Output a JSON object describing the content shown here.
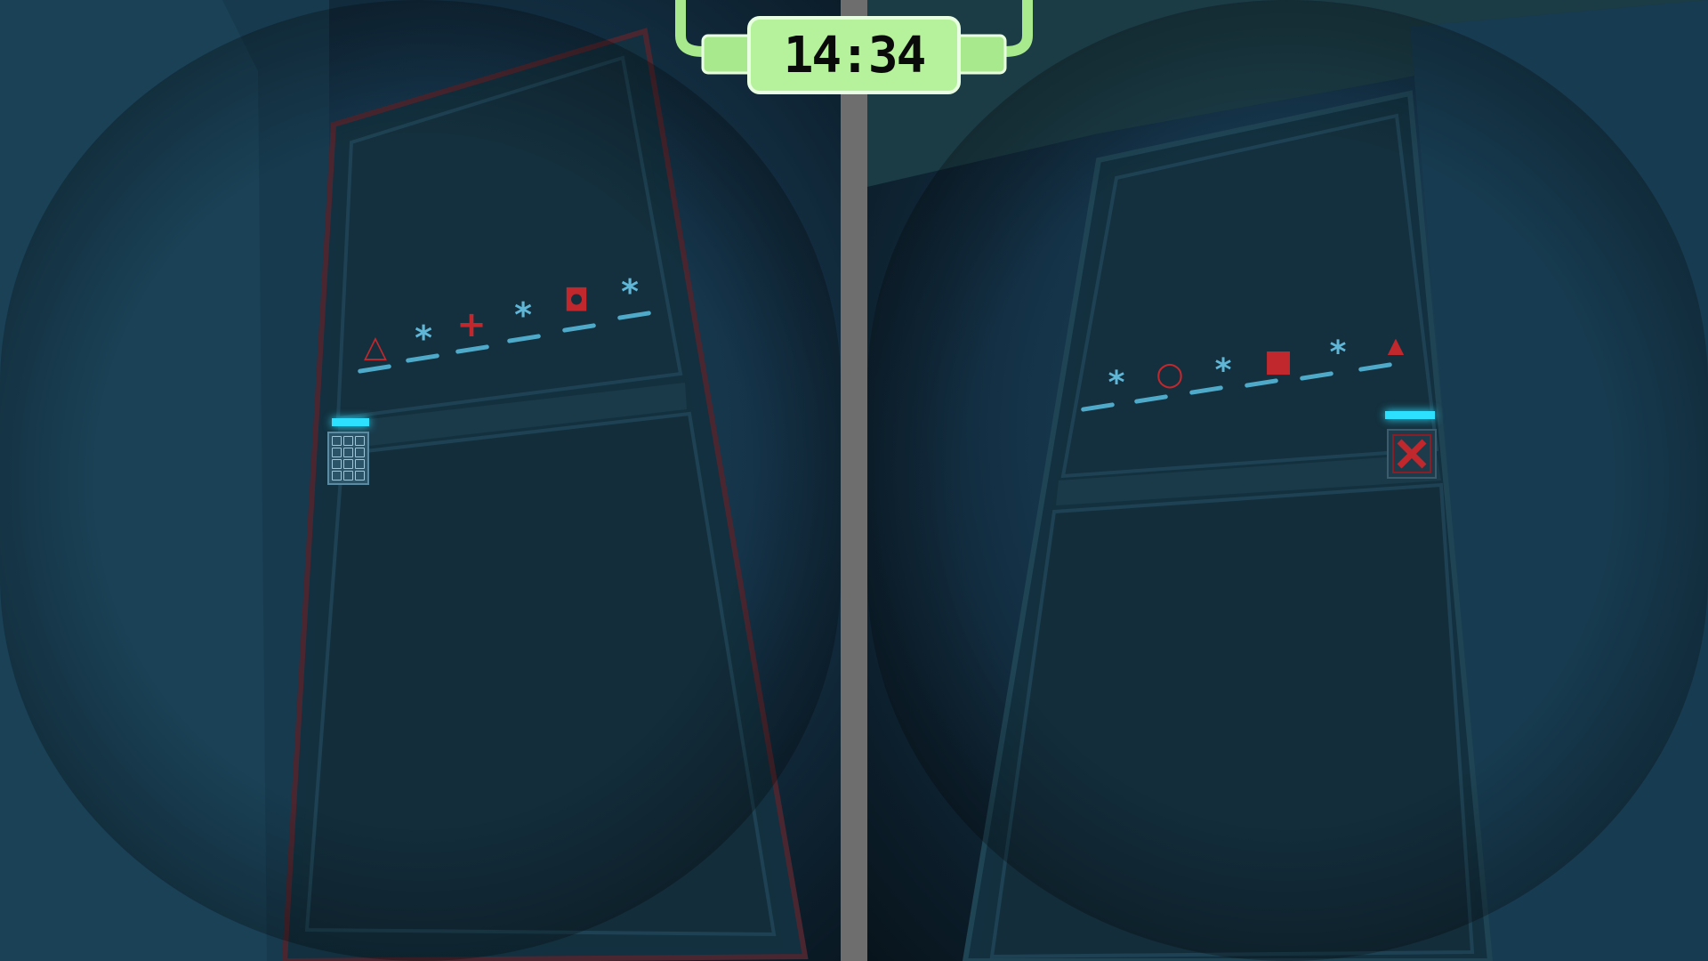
{
  "hud": {
    "timer": "14:34",
    "timer_color": "#b6f29b"
  },
  "left_view": {
    "code_symbols": [
      "△",
      "*",
      "+",
      "*",
      "◘",
      "*"
    ],
    "symbol_colors": [
      "#c0282e",
      "#5fb6d6",
      "#c0282e",
      "#5fb6d6",
      "#c0282e",
      "#5fb6d6"
    ],
    "panel_icon": "keypad-icon",
    "indicator_color": "#2ee0ff"
  },
  "right_view": {
    "code_symbols": [
      "*",
      "○",
      "*",
      "■",
      "*",
      "▲"
    ],
    "symbol_colors": [
      "#5fb6d6",
      "#c0282e",
      "#5fb6d6",
      "#c0282e",
      "#5fb6d6",
      "#c0282e"
    ],
    "panel_icon": "red-x-icon",
    "indicator_color": "#2ee0ff"
  }
}
